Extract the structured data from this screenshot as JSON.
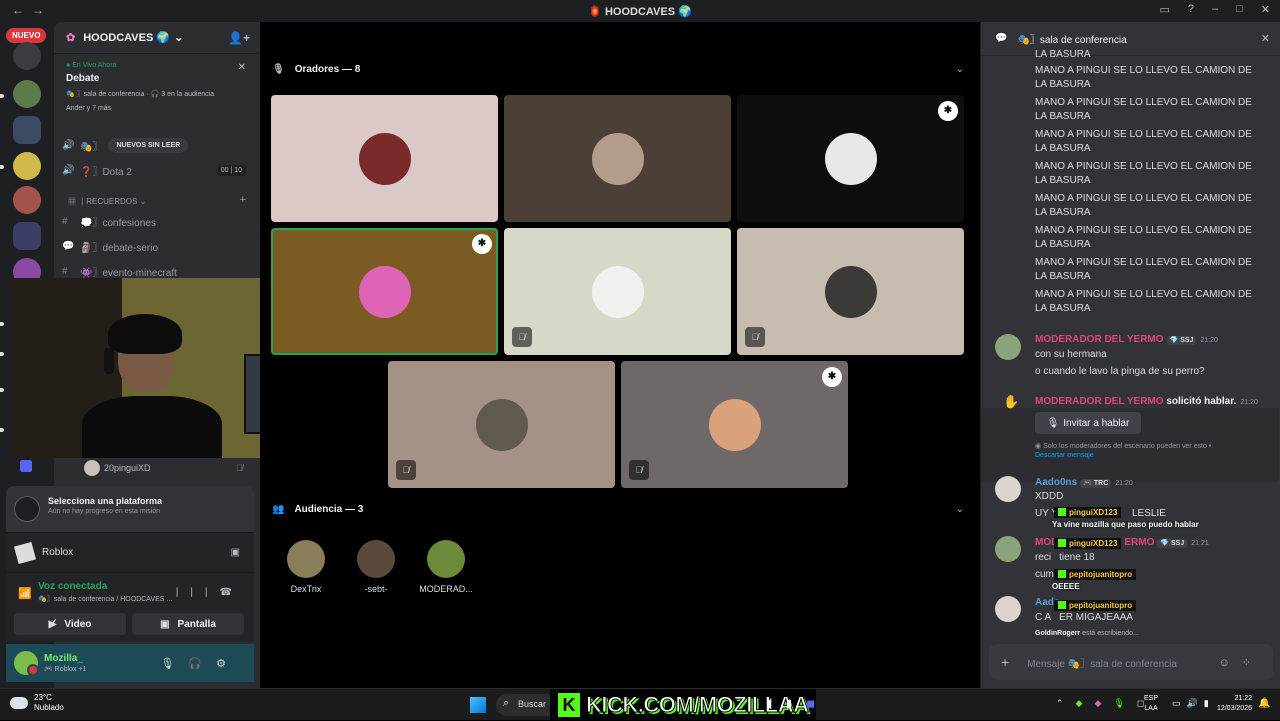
{
  "titlebar": {
    "title": "🏮 HOODCAVES 🌍",
    "back": "←",
    "forward": "→"
  },
  "rail": {
    "nuevo_badge": "NUEVO"
  },
  "sidebar": {
    "server_name": "HOODCAVES 🌍",
    "live": {
      "status": "En Vivo Ahora",
      "title": "Debate",
      "meta": "🎭 〗sala de conferencia · 🎧 3 en la audiencia",
      "people": "Ander y 7 más"
    },
    "channels": [
      {
        "icon": "🔊",
        "name": "🎭〗",
        "extra": "NUEVOS SIN LEER"
      },
      {
        "icon": "🔊",
        "name": "❓〗Dota 2",
        "counts": "00 | 10"
      }
    ],
    "category": "〡RECUERDOS",
    "text_channels": [
      {
        "icon": "#",
        "name": "💭〗confesiones"
      },
      {
        "icon": "💬",
        "name": "🗿〗debate-serio"
      },
      {
        "icon": "#",
        "name": "👾〗evento-minecraft"
      }
    ],
    "voice_user": "20pinguiXD",
    "quest": {
      "title": "Selecciona una plataforma",
      "subtitle": "Aún no hay progreso en esta misión"
    },
    "activity": "Roblox",
    "voice": {
      "status": "Voz conectada",
      "channel": "🎭〗sala de conferencia / HOODCAVES ...",
      "video_label": "Video",
      "screen_label": "Pantalla"
    },
    "user": {
      "name": "Mozilla_",
      "status": "🎮 Roblox +1"
    }
  },
  "stage": {
    "speakers_header": "Oradores — 8",
    "audience_header": "Audiencia — 3",
    "audience": [
      {
        "name": "DexTrix",
        "color": "#8a7d5a"
      },
      {
        "name": "-sebt-",
        "color": "#5a4a3c"
      },
      {
        "name": "MODERAD...",
        "color": "#6b8a3a"
      }
    ]
  },
  "chat": {
    "header": "🎭〗sala de conferencia",
    "spam_top": "LA BASURA",
    "spam_line1": "MANO A PINGUI SE LO LLEVO EL CAMION DE",
    "spam_line2": "LA BASURA",
    "moderator_name": "MODERADOR DEL YERMO",
    "moderator_tag": "💎 SSJ",
    "msg1_time": "21:20",
    "msg1_a": "con su hermana",
    "msg1_b": "o cuando le lavo la pinga de su perro?",
    "request_name": "MODERADOR DEL YERMO",
    "request_text": "solicitó hablar.",
    "request_time": "21:20",
    "invite_label": "Invitar a hablar",
    "request_note": "Solo los moderadores del escenario pueden ver esto •",
    "dismiss": "Descartar mensaje",
    "aado_name": "Aado0ns",
    "aado_tag": "🎮 TRC",
    "aado_time": "21:20",
    "aado_msg1": "XDDD",
    "aado_msg2": "UY Y",
    "aado_msg2_end": "LESLIE",
    "mod2_name": "MOD",
    "mod2_name_end": "ERMO",
    "mod2_time": "21:21",
    "mod2_msg1": "reci",
    "mod2_msg1_end": "tiene 18",
    "mod2_msg2": "cum",
    "aado2_name": "Aado",
    "aado2_msg": "C A",
    "aado2_msg_end": "ER MIGAJEAAA",
    "typing_user": "GoldinRogerr",
    "typing_text": "está escribiendo...",
    "composer_placeholder": "Mensaje 🎭〗sala de conferencia"
  },
  "overlay": {
    "user1": "pinguiXD123",
    "msg1": "Ya vine mozilla que paso puedo hablar",
    "user2": "pinguiXD123",
    "user3": "pepitojuanitopro",
    "msg3": "OEEEE",
    "user4": "pepitojuanitopro"
  },
  "taskbar": {
    "temp": "23°C",
    "weather": "Nublado",
    "search": "Buscar",
    "kick_text": "KICK.COM/MOZILLAA",
    "lang1": "ESP",
    "lang2": "LAA",
    "time": "21:22",
    "date": "12/03/2026"
  }
}
